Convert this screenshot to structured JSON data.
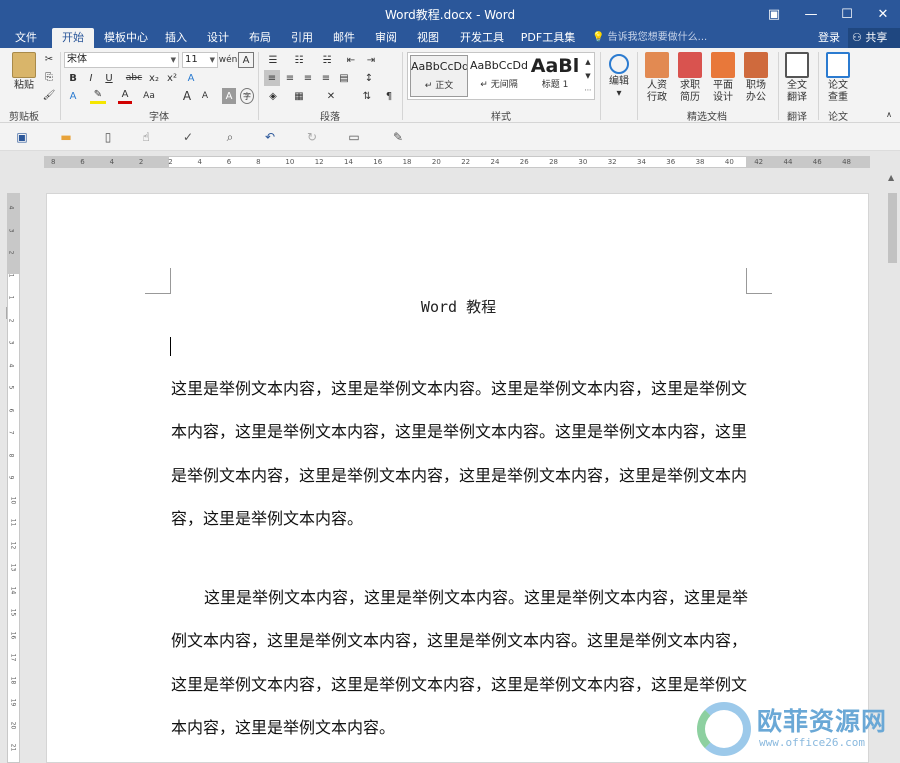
{
  "app": {
    "window_title": "Word教程.docx - Word",
    "window_buttons": [
      "▣",
      "—",
      "☐",
      "✕"
    ]
  },
  "tabs": [
    "文件",
    "开始",
    "模板中心",
    "插入",
    "设计",
    "布局",
    "引用",
    "邮件",
    "审阅",
    "视图",
    "开发工具",
    "PDF工具集"
  ],
  "active_tab": "开始",
  "tell_me": "告诉我您想要做什么...",
  "login": "登录",
  "share": "共享",
  "ribbon": {
    "clipboard": {
      "paste": "粘贴",
      "label": "剪贴板"
    },
    "font": {
      "name": "宋体",
      "size": "11",
      "label": "字体",
      "buttons": [
        "B",
        "I",
        "U",
        "abc",
        "x₂",
        "x²",
        "A",
        "A",
        "A",
        "A",
        "Aa",
        "A",
        "A"
      ]
    },
    "paragraph": {
      "label": "段落"
    },
    "styles": {
      "label": "样式",
      "items": [
        {
          "sample": "AaBbCcDd",
          "name": "↵ 正文"
        },
        {
          "sample": "AaBbCcDd",
          "name": "↵ 无间隔"
        },
        {
          "sample": "AaBl",
          "name": "标题 1"
        }
      ]
    },
    "editing": {
      "label": "编辑"
    },
    "featured": {
      "label": "精选文档",
      "items": [
        "人资\n行政",
        "求职\n简历",
        "平面\n设计",
        "职场\n办公"
      ]
    },
    "translate": {
      "item": "全文\n翻译",
      "label": "翻译"
    },
    "thesis": {
      "item": "论文\n查重",
      "label": "论文"
    }
  },
  "quick_access_icons": [
    "save-icon",
    "open-icon",
    "new-icon",
    "touch-mode-icon",
    "spelling-icon",
    "print-preview-icon",
    "undo-icon",
    "redo-icon",
    "screen-icon",
    "edit-icon"
  ],
  "ruler": {
    "h_ticks": [
      "8",
      "6",
      "4",
      "2",
      "2",
      "4",
      "6",
      "8",
      "10",
      "12",
      "14",
      "16",
      "18",
      "20",
      "22",
      "24",
      "26",
      "28",
      "30",
      "32",
      "34",
      "36",
      "38",
      "40",
      "42",
      "44",
      "46",
      "48"
    ],
    "v_ticks": [
      "4",
      "3",
      "2",
      "1",
      "1",
      "2",
      "3",
      "4",
      "5",
      "6",
      "7",
      "8",
      "9",
      "10",
      "11",
      "12",
      "13",
      "14",
      "15",
      "16",
      "17",
      "18",
      "19",
      "20",
      "21"
    ]
  },
  "document": {
    "title": "Word 教程",
    "paragraphs": [
      "这里是举例文本内容，这里是举例文本内容。这里是举例文本内容，这里是举例文本内容，这里是举例文本内容，这里是举例文本内容。这里是举例文本内容，这里是举例文本内容，这里是举例文本内容，这里是举例文本内容，这里是举例文本内容，这里是举例文本内容。",
      "这里是举例文本内容，这里是举例文本内容。这里是举例文本内容，这里是举例文本内容，这里是举例文本内容，这里是举例文本内容。这里是举例文本内容，这里是举例文本内容，这里是举例文本内容，这里是举例文本内容，这里是举例文本内容，这里是举例文本内容。"
    ]
  },
  "watermark": {
    "name": "欧菲资源网",
    "url": "www.office26.com"
  },
  "colors": {
    "title_bar": "#2b579a",
    "ribbon_bg": "#f3f3f3",
    "page_bg": "#ffffff"
  }
}
